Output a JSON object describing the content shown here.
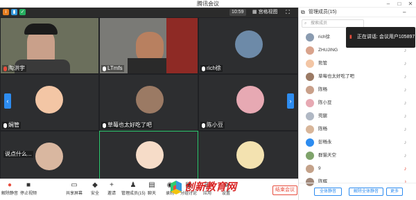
{
  "window": {
    "title": "腾讯会议"
  },
  "topbar": {
    "timer": "10:59",
    "view_label": "宫格视图"
  },
  "tiles": [
    {
      "name": "陶洪宇"
    },
    {
      "name": "LTmfs"
    },
    {
      "name": "rich徐"
    },
    {
      "name": "娴管"
    },
    {
      "name": "草莓也太好吃了吧"
    },
    {
      "name": "陈小豆"
    },
    {
      "name": "说点什么..."
    },
    {
      "name": ""
    },
    {
      "name": ""
    }
  ],
  "toolbar": {
    "items": [
      "解除静音",
      "停止视频",
      "共享屏幕",
      "安全",
      "邀请",
      "管理成员(15)",
      "聊天",
      "录制",
      "分组讨论",
      "应用",
      "设置"
    ],
    "end_label": "结束会议"
  },
  "watermark": {
    "text": "创新教育网"
  },
  "panel": {
    "title": "管理成员(15)",
    "search_placeholder": "搜索成员",
    "tooltip": "正在讲话: 会议用户105897",
    "members": [
      "rich徐",
      "ZHUJING",
      "熊管",
      "草莓也太好吃了吧",
      "陈畅",
      "陈小豆",
      "兜腿",
      "陈畅",
      "彭畅永",
      "群猫天空",
      "9",
      "陈辉"
    ],
    "mute_all": "全体静音",
    "unmute_all": "解除全体静音",
    "more": "更多"
  },
  "colors": {
    "accent": "#2d8cf0",
    "danger": "#e74c3c",
    "video_bg": "#202124"
  }
}
